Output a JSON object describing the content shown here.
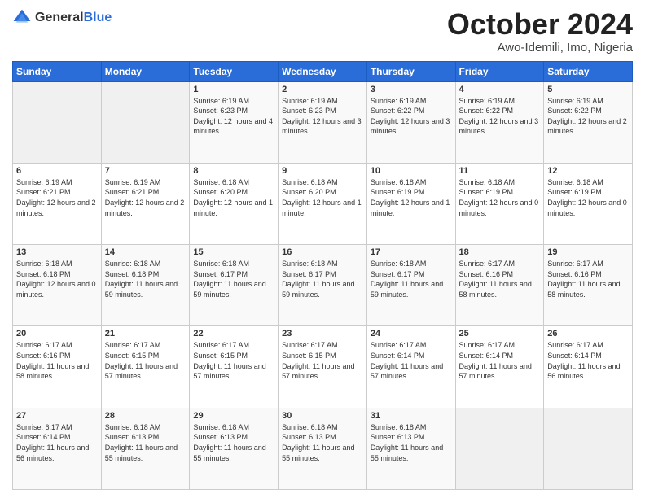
{
  "header": {
    "logo_general": "General",
    "logo_blue": "Blue",
    "title": "October 2024",
    "location": "Awo-Idemili, Imo, Nigeria"
  },
  "days_of_week": [
    "Sunday",
    "Monday",
    "Tuesday",
    "Wednesday",
    "Thursday",
    "Friday",
    "Saturday"
  ],
  "weeks": [
    [
      {
        "day": "",
        "info": ""
      },
      {
        "day": "",
        "info": ""
      },
      {
        "day": "1",
        "info": "Sunrise: 6:19 AM\nSunset: 6:23 PM\nDaylight: 12 hours and 4 minutes."
      },
      {
        "day": "2",
        "info": "Sunrise: 6:19 AM\nSunset: 6:23 PM\nDaylight: 12 hours and 3 minutes."
      },
      {
        "day": "3",
        "info": "Sunrise: 6:19 AM\nSunset: 6:22 PM\nDaylight: 12 hours and 3 minutes."
      },
      {
        "day": "4",
        "info": "Sunrise: 6:19 AM\nSunset: 6:22 PM\nDaylight: 12 hours and 3 minutes."
      },
      {
        "day": "5",
        "info": "Sunrise: 6:19 AM\nSunset: 6:22 PM\nDaylight: 12 hours and 2 minutes."
      }
    ],
    [
      {
        "day": "6",
        "info": "Sunrise: 6:19 AM\nSunset: 6:21 PM\nDaylight: 12 hours and 2 minutes."
      },
      {
        "day": "7",
        "info": "Sunrise: 6:19 AM\nSunset: 6:21 PM\nDaylight: 12 hours and 2 minutes."
      },
      {
        "day": "8",
        "info": "Sunrise: 6:18 AM\nSunset: 6:20 PM\nDaylight: 12 hours and 1 minute."
      },
      {
        "day": "9",
        "info": "Sunrise: 6:18 AM\nSunset: 6:20 PM\nDaylight: 12 hours and 1 minute."
      },
      {
        "day": "10",
        "info": "Sunrise: 6:18 AM\nSunset: 6:19 PM\nDaylight: 12 hours and 1 minute."
      },
      {
        "day": "11",
        "info": "Sunrise: 6:18 AM\nSunset: 6:19 PM\nDaylight: 12 hours and 0 minutes."
      },
      {
        "day": "12",
        "info": "Sunrise: 6:18 AM\nSunset: 6:19 PM\nDaylight: 12 hours and 0 minutes."
      }
    ],
    [
      {
        "day": "13",
        "info": "Sunrise: 6:18 AM\nSunset: 6:18 PM\nDaylight: 12 hours and 0 minutes."
      },
      {
        "day": "14",
        "info": "Sunrise: 6:18 AM\nSunset: 6:18 PM\nDaylight: 11 hours and 59 minutes."
      },
      {
        "day": "15",
        "info": "Sunrise: 6:18 AM\nSunset: 6:17 PM\nDaylight: 11 hours and 59 minutes."
      },
      {
        "day": "16",
        "info": "Sunrise: 6:18 AM\nSunset: 6:17 PM\nDaylight: 11 hours and 59 minutes."
      },
      {
        "day": "17",
        "info": "Sunrise: 6:18 AM\nSunset: 6:17 PM\nDaylight: 11 hours and 59 minutes."
      },
      {
        "day": "18",
        "info": "Sunrise: 6:17 AM\nSunset: 6:16 PM\nDaylight: 11 hours and 58 minutes."
      },
      {
        "day": "19",
        "info": "Sunrise: 6:17 AM\nSunset: 6:16 PM\nDaylight: 11 hours and 58 minutes."
      }
    ],
    [
      {
        "day": "20",
        "info": "Sunrise: 6:17 AM\nSunset: 6:16 PM\nDaylight: 11 hours and 58 minutes."
      },
      {
        "day": "21",
        "info": "Sunrise: 6:17 AM\nSunset: 6:15 PM\nDaylight: 11 hours and 57 minutes."
      },
      {
        "day": "22",
        "info": "Sunrise: 6:17 AM\nSunset: 6:15 PM\nDaylight: 11 hours and 57 minutes."
      },
      {
        "day": "23",
        "info": "Sunrise: 6:17 AM\nSunset: 6:15 PM\nDaylight: 11 hours and 57 minutes."
      },
      {
        "day": "24",
        "info": "Sunrise: 6:17 AM\nSunset: 6:14 PM\nDaylight: 11 hours and 57 minutes."
      },
      {
        "day": "25",
        "info": "Sunrise: 6:17 AM\nSunset: 6:14 PM\nDaylight: 11 hours and 57 minutes."
      },
      {
        "day": "26",
        "info": "Sunrise: 6:17 AM\nSunset: 6:14 PM\nDaylight: 11 hours and 56 minutes."
      }
    ],
    [
      {
        "day": "27",
        "info": "Sunrise: 6:17 AM\nSunset: 6:14 PM\nDaylight: 11 hours and 56 minutes."
      },
      {
        "day": "28",
        "info": "Sunrise: 6:18 AM\nSunset: 6:13 PM\nDaylight: 11 hours and 55 minutes."
      },
      {
        "day": "29",
        "info": "Sunrise: 6:18 AM\nSunset: 6:13 PM\nDaylight: 11 hours and 55 minutes."
      },
      {
        "day": "30",
        "info": "Sunrise: 6:18 AM\nSunset: 6:13 PM\nDaylight: 11 hours and 55 minutes."
      },
      {
        "day": "31",
        "info": "Sunrise: 6:18 AM\nSunset: 6:13 PM\nDaylight: 11 hours and 55 minutes."
      },
      {
        "day": "",
        "info": ""
      },
      {
        "day": "",
        "info": ""
      }
    ]
  ]
}
